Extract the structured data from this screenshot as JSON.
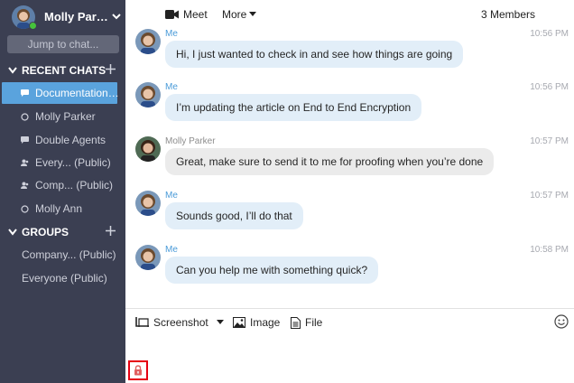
{
  "user": {
    "name": "Molly Parker",
    "display_name": "Molly Par…",
    "status_color": "#46c33b"
  },
  "search": {
    "placeholder": "Jump to chat..."
  },
  "sidebar": {
    "recent_header": "RECENT CHATS",
    "recent_items": [
      {
        "label": "Documentation…",
        "icon": "chat-bubble-icon",
        "active": true
      },
      {
        "label": "Molly Parker",
        "icon": "status-circle-icon",
        "active": false
      },
      {
        "label": "Double Agents",
        "icon": "chat-bubble-icon",
        "active": false
      },
      {
        "label": "Every... (Public)",
        "icon": "people-icon",
        "active": false
      },
      {
        "label": "Comp... (Public)",
        "icon": "people-icon",
        "active": false
      },
      {
        "label": "Molly Ann",
        "icon": "status-circle-icon",
        "active": false
      }
    ],
    "groups_header": "GROUPS",
    "group_items": [
      {
        "label": "Company... (Public)"
      },
      {
        "label": "Everyone (Public)"
      }
    ]
  },
  "toolbar": {
    "meet_label": "Meet",
    "more_label": "More",
    "members_label": "3 Members"
  },
  "messages": [
    {
      "sender": "Me",
      "time": "10:56 PM",
      "text": "Hi, I just wanted to check in and see how things are going",
      "mine": true
    },
    {
      "sender": "Me",
      "time": "10:56 PM",
      "text": "I’m updating the article on End to End Encryption",
      "mine": true
    },
    {
      "sender": "Molly Parker",
      "time": "10:57 PM",
      "text": "Great, make sure to send it to me for proofing when you’re done",
      "mine": false
    },
    {
      "sender": "Me",
      "time": "10:57 PM",
      "text": "Sounds good, I’ll do that",
      "mine": true
    },
    {
      "sender": "Me",
      "time": "10:58 PM",
      "text": "Can you help me with something quick?",
      "mine": true
    }
  ],
  "composer": {
    "screenshot_label": "Screenshot",
    "image_label": "Image",
    "file_label": "File"
  },
  "colors": {
    "sidebar_bg": "#3b3f52",
    "active_item": "#5aa3dd",
    "my_bubble": "#e2eef8",
    "other_bubble": "#ebebeb",
    "accent_name": "#4a9bd8",
    "lock_highlight": "#e60012"
  }
}
